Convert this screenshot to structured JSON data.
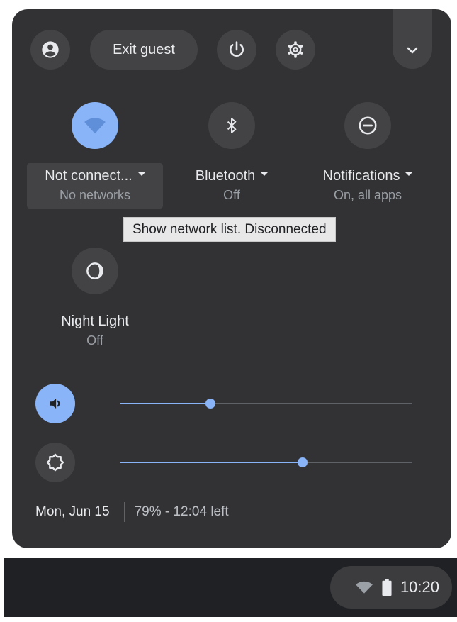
{
  "top_row": {
    "exit_label": "Exit guest"
  },
  "features": [
    {
      "label": "Not connect...",
      "sub": "No networks",
      "icon": "wifi-icon"
    },
    {
      "label": "Bluetooth",
      "sub": "Off",
      "icon": "bluetooth-icon"
    },
    {
      "label": "Notifications",
      "sub": "On, all apps",
      "icon": "do-not-disturb-icon"
    },
    {
      "label": "Night Light",
      "sub": "Off",
      "icon": "night-light-icon"
    }
  ],
  "tooltip": "Show network list. Disconnected",
  "sliders": {
    "volume_level": 0.31,
    "brightness_level": 0.625
  },
  "footer": {
    "date": "Mon, Jun 15",
    "battery": "79% - 12:04 left"
  },
  "shelf": {
    "time": "10:20"
  },
  "colors": {
    "accent": "#8ab4f8",
    "panel": "#323234",
    "button": "#434345"
  }
}
